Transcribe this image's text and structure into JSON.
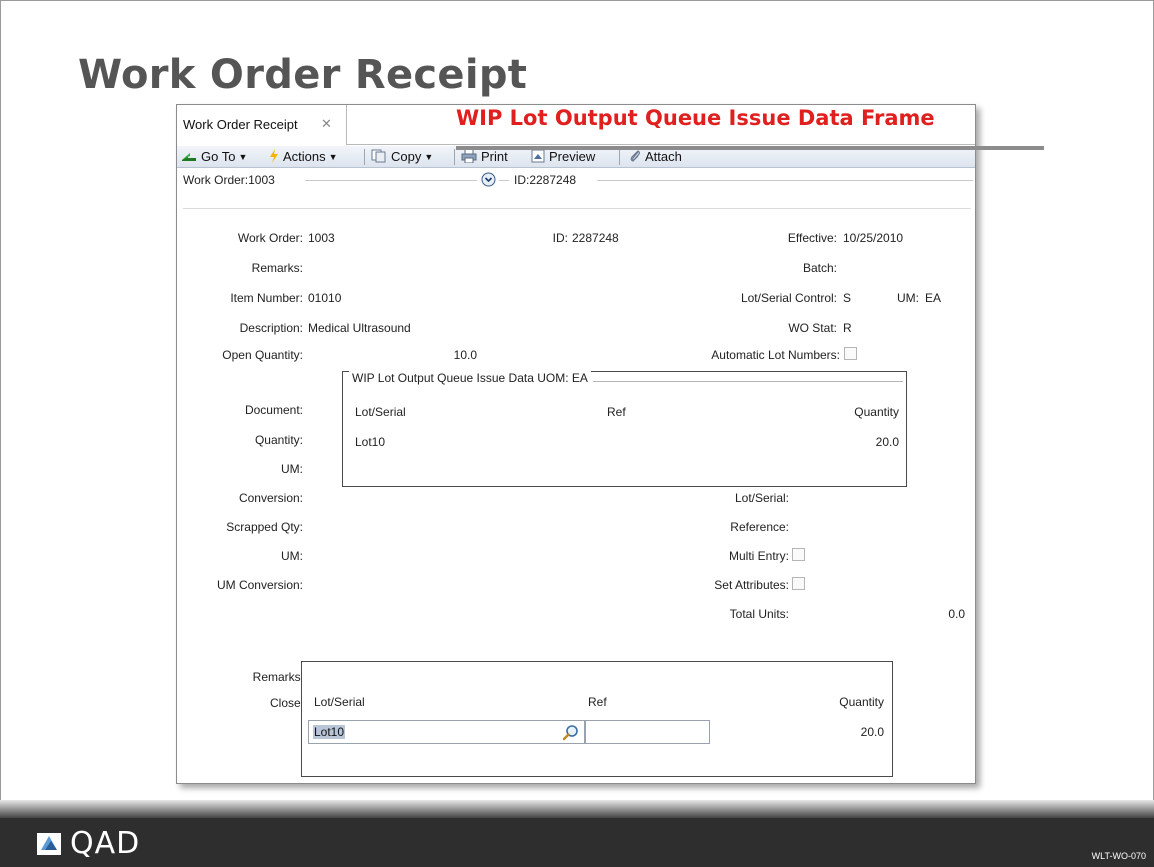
{
  "slide": {
    "title": "Work Order Receipt",
    "callout": "WIP Lot Output Queue Issue Data Frame",
    "footer_code": "WLT-WO-070",
    "logo_text": "QAD"
  },
  "window": {
    "tab_label": "Work Order Receipt",
    "tab_close": "✕",
    "toolbar": {
      "goto": "Go To",
      "actions": "Actions",
      "copy": "Copy",
      "print": "Print",
      "preview": "Preview",
      "attach": "Attach"
    },
    "frame_header": {
      "left": "Work Order:1003",
      "right": "ID:2287248"
    }
  },
  "form": {
    "work_order_label": "Work Order:",
    "work_order_value": "1003",
    "id_label": "ID:",
    "id_value": "2287248",
    "effective_label": "Effective:",
    "effective_value": "10/25/2010",
    "remarks_label": "Remarks:",
    "batch_label": "Batch:",
    "item_number_label": "Item Number:",
    "item_number_value": "01010",
    "lot_serial_control_label": "Lot/Serial Control:",
    "lot_serial_control_value": "S",
    "um_label": "UM:",
    "um_value": "EA",
    "description_label": "Description:",
    "description_value": "Medical Ultrasound",
    "wo_stat_label": "WO Stat:",
    "wo_stat_value": "R",
    "open_qty_label": "Open Quantity:",
    "open_qty_value": "10.0",
    "auto_lot_label": "Automatic Lot Numbers:",
    "document_label": "Document:",
    "quantity_label": "Quantity:",
    "um2_label": "UM:",
    "conversion_label": "Conversion:",
    "scrapped_qty_label": "Scrapped Qty:",
    "um3_label": "UM:",
    "um_conversion_label": "UM Conversion:",
    "lot_serial_label": "Lot/Serial:",
    "reference_label": "Reference:",
    "multi_entry_label": "Multi Entry:",
    "set_attributes_label": "Set Attributes:",
    "total_units_label": "Total Units:",
    "total_units_value": "0.0",
    "remarks2_label": "Remarks:",
    "close_label": "Close:"
  },
  "wip_frame": {
    "legend": "WIP Lot Output Queue Issue Data  UOM: EA",
    "columns": [
      "Lot/Serial",
      "Ref",
      "Quantity"
    ],
    "rows": [
      {
        "lot": "Lot10",
        "ref": "",
        "qty": "20.0"
      }
    ]
  },
  "entry_frame": {
    "columns": [
      "Lot/Serial",
      "Ref",
      "Quantity"
    ],
    "lot_value": "Lot10",
    "ref_value": "",
    "qty_value": "20.0"
  }
}
